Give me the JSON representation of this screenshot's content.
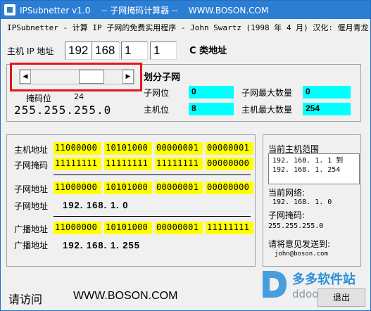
{
  "window": {
    "title": "IPSubnetter v1.0    -- 子网掩码计算器 --    WWW.BOSON.COM",
    "subtitle": "IPSubnetter - 计算 IP 子网的免费实用程序 - John Swartz (1998 年 4 月) 汉化: 偃月青龙"
  },
  "ip": {
    "label": "主机 IP 地址",
    "octets": [
      "192",
      "168",
      "1",
      "1"
    ],
    "class_label": "C 类地址"
  },
  "mask": {
    "label": "掩码位",
    "bits": "24",
    "value": "255.255.255.0",
    "slider_fraction": 0.72
  },
  "subnet": {
    "heading": "划分子网",
    "subnet_bits_label": "子网位",
    "subnet_bits": "0",
    "max_subnets_label": "子网最大数量",
    "max_subnets": "0",
    "host_bits_label": "主机位",
    "host_bits": "8",
    "max_hosts_label": "主机最大数量",
    "max_hosts": "254"
  },
  "binary": {
    "host_addr_label": "主机地址",
    "host_addr": [
      "11000000",
      "10101000",
      "00000001",
      "00000001"
    ],
    "subnet_mask_label": "子网掩码",
    "subnet_mask": [
      "11111111",
      "11111111",
      "11111111",
      "00000000"
    ],
    "subnet_addr_label": "子网地址",
    "subnet_addr": [
      "11000000",
      "10101000",
      "00000001",
      "00000000"
    ],
    "subnet_addr2_label": "子网地址",
    "subnet_addr_dotted": "192. 168. 1. 0",
    "broadcast_label": "广播地址",
    "broadcast": [
      "11000000",
      "10101000",
      "00000001",
      "11111111"
    ],
    "broadcast2_label": "广播地址",
    "broadcast_dotted": "192. 168. 1. 255"
  },
  "right_panel": {
    "range_label": "当前主机范围",
    "range_line1": "192. 168. 1. 1 到",
    "range_line2": "192. 168. 1. 254",
    "network_label": "当前网络:",
    "network_value": "192. 168. 1. 0",
    "mask_label": "子网掩码:",
    "mask_value": "255.255.255.0",
    "feedback_label": "请将意见发送到:",
    "feedback_email": "john@boson.com"
  },
  "footer": {
    "visit": "请访问",
    "url": "WWW.BOSON.COM",
    "exit": "退出"
  },
  "watermark": {
    "line1": "多多软件站",
    "line2": "ddooo.com"
  },
  "colors": {
    "titlebar": "#2c7ed3",
    "cyan": "#00ffff",
    "yellow": "#ffff00",
    "highlight": "#e8141a"
  }
}
